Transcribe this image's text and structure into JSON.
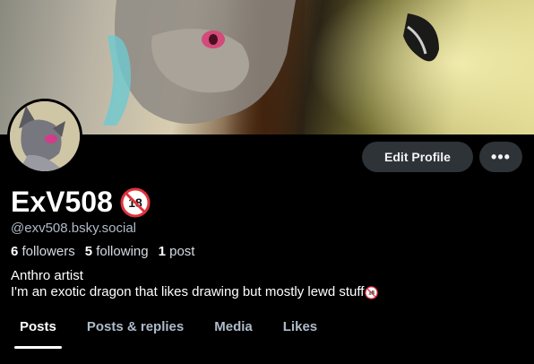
{
  "profile": {
    "display_name": "ExV508",
    "handle": "@exv508.bsky.social",
    "adult_badge_icon": "adult-content-18-icon"
  },
  "stats": {
    "followers_count": "6",
    "followers_label": "followers",
    "following_count": "5",
    "following_label": "following",
    "posts_count": "1",
    "posts_label": "post"
  },
  "bio": {
    "line1": "Anthro artist",
    "line2": "I'm an exotic dragon that likes drawing but mostly lewd stuff"
  },
  "actions": {
    "edit_profile": "Edit Profile",
    "more": "•••"
  },
  "tabs": [
    {
      "label": "Posts",
      "active": true
    },
    {
      "label": "Posts & replies",
      "active": false
    },
    {
      "label": "Media",
      "active": false
    },
    {
      "label": "Likes",
      "active": false
    }
  ],
  "colors": {
    "background": "#000000",
    "button_bg": "#2e3338",
    "muted_text": "#aebbc9",
    "badge_red": "#e0323c"
  }
}
